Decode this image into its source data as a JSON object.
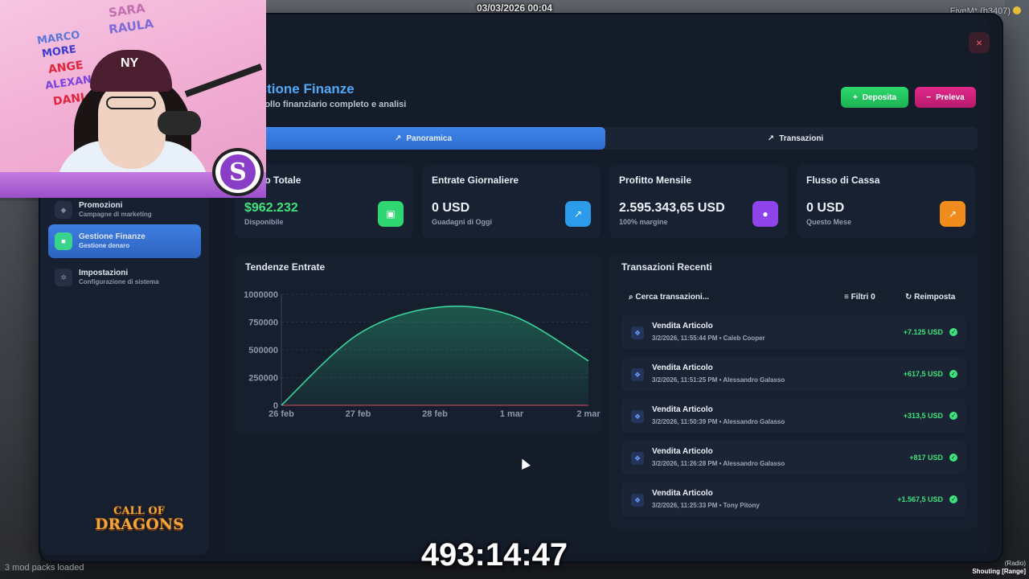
{
  "overlay": {
    "datetime": "03/03/2026 00:04",
    "server_tag": "FiveM* (b3407)",
    "timer": "493:14:47",
    "bottom_left": "3 mod packs loaded",
    "voice_range": "Shouting [Range]",
    "voice_radio": "(Radio)"
  },
  "sidebar": {
    "items": [
      {
        "title": "Promozioni",
        "subtitle": "Campagne di marketing",
        "icon": "megaphone-icon"
      },
      {
        "title": "Gestione Finanze",
        "subtitle": "Gestione denaro",
        "icon": "wallet-icon",
        "active": true
      },
      {
        "title": "Impostazioni",
        "subtitle": "Configurazione di sistema",
        "icon": "gear-icon"
      }
    ],
    "logo_line1": "CALL OF",
    "logo_line2": "DRAGONS"
  },
  "header": {
    "title": "Gestione Finanze",
    "subtitle": "Controllo finanziario completo e analisi",
    "deposit_label": "Deposita",
    "withdraw_label": "Preleva",
    "close_glyph": "×"
  },
  "tabs": [
    {
      "label": "Panoramica",
      "active": true
    },
    {
      "label": "Transazioni",
      "active": false
    }
  ],
  "stats": [
    {
      "label": "Saldo Totale",
      "value": "$962.232",
      "sub": "Disponibile",
      "icon": "wallet-icon",
      "color": "#2fd672"
    },
    {
      "label": "Entrate Giornaliere",
      "value": "0 USD",
      "sub": "Guadagni di Oggi",
      "icon": "trend-up-icon",
      "color": "#2b9bea"
    },
    {
      "label": "Profitto Mensile",
      "value": "2.595.343,65 USD",
      "sub": "100% margine",
      "icon": "piggy-bank-icon",
      "color": "#8e44e8"
    },
    {
      "label": "Flusso di Cassa",
      "value": "0 USD",
      "sub": "Questo Mese",
      "icon": "chart-up-icon",
      "color": "#f08c1c"
    }
  ],
  "chart_card": {
    "title": "Tendenze Entrate"
  },
  "chart_data": {
    "type": "area",
    "title": "Tendenze Entrate",
    "x": [
      "26 feb",
      "27 feb",
      "28 feb",
      "1 mar",
      "2 mar"
    ],
    "series": [
      {
        "values": [
          0,
          640000,
          880000,
          810000,
          400000
        ],
        "color": "#3bd39a"
      }
    ],
    "yticks": [
      "0",
      "250000",
      "500000",
      "750000",
      "1000000"
    ],
    "ylim": [
      0,
      1000000
    ],
    "grid": true
  },
  "transactions": {
    "title": "Transazioni Recenti",
    "search_placeholder": "Cerca transazioni...",
    "filters_label": "Filtri 0",
    "reset_label": "Reimposta",
    "rows": [
      {
        "title": "Vendita Articolo",
        "meta": "3/2/2026, 11:55:44 PM • Caleb Cooper",
        "amount": "+7.125 USD"
      },
      {
        "title": "Vendita Articolo",
        "meta": "3/2/2026, 11:51:25 PM • Alessandro Galasso",
        "amount": "+617,5 USD"
      },
      {
        "title": "Vendita Articolo",
        "meta": "3/2/2026, 11:50:39 PM • Alessandro Galasso",
        "amount": "+313,5 USD"
      },
      {
        "title": "Vendita Articolo",
        "meta": "3/2/2026, 11:26:28 PM • Alessandro Galasso",
        "amount": "+817 USD"
      },
      {
        "title": "Vendita Articolo",
        "meta": "3/2/2026, 11:25:33 PM • Tony Pitony",
        "amount": "+1.567,5 USD"
      }
    ]
  },
  "webcam": {
    "wall_text": [
      "SARA",
      "RAULA",
      "MARCO",
      "MORE",
      "ANGE",
      "ALEXAND",
      "DANI"
    ],
    "cap_logo": "NY",
    "channel_logo": "S"
  }
}
